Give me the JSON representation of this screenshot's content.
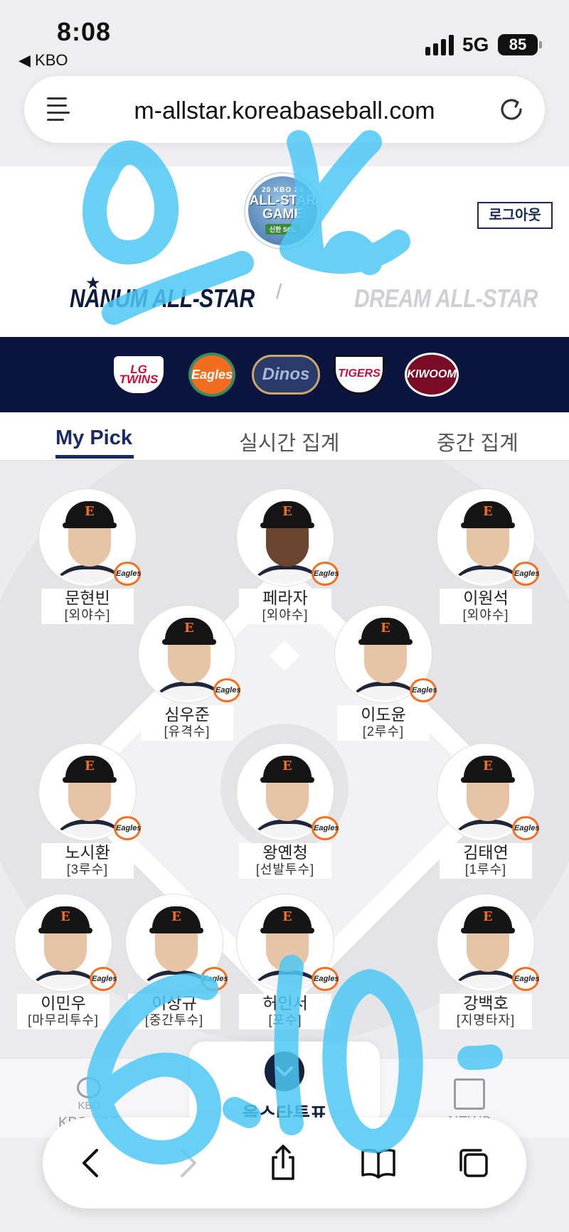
{
  "status": {
    "time": "8:08",
    "back_app": "◀ KBO",
    "network": "5G",
    "battery": "85"
  },
  "browser": {
    "url": "m-allstar.koreabaseball.com"
  },
  "header": {
    "logo_lines": [
      "20 KBO 24",
      "ALL-STAR",
      "GAME",
      "신한 SOL"
    ],
    "logout": "로그아웃",
    "nanum": "NANUM ALL-STAR",
    "divider": "/",
    "dream": "DREAM ALL-STAR"
  },
  "teams": [
    {
      "name": "LG TWINS",
      "short": "LG TWINS"
    },
    {
      "name": "Eagles",
      "short": "Eagles"
    },
    {
      "name": "NC Dinos",
      "short": "Dinos"
    },
    {
      "name": "KIA TIGERS",
      "short": "TIGERS"
    },
    {
      "name": "KIWOOM",
      "short": "KIWOOM"
    }
  ],
  "tabs": [
    "My Pick",
    "실시간 집계",
    "중간 집계"
  ],
  "badge_text": "Eagles",
  "players": [
    {
      "name": "문현빈",
      "position": "[외야수]"
    },
    {
      "name": "페라자",
      "position": "[외야수]"
    },
    {
      "name": "이원석",
      "position": "[외야수]"
    },
    {
      "name": "심우준",
      "position": "[유격수]"
    },
    {
      "name": "이도윤",
      "position": "[2루수]"
    },
    {
      "name": "노시환",
      "position": "[3루수]"
    },
    {
      "name": "왕옌청",
      "position": "[선발투수]"
    },
    {
      "name": "김태연",
      "position": "[1루수]"
    },
    {
      "name": "이민우",
      "position": "[마무리투수]"
    },
    {
      "name": "이상규",
      "position": "[중간투수]"
    },
    {
      "name": "허인서",
      "position": "[포수]"
    },
    {
      "name": "강백호",
      "position": "[지명타자]"
    }
  ],
  "bottom_nav": {
    "left_logo": "KBO",
    "left": "KBO APP",
    "center": "올스타투표",
    "right": "NEWS"
  },
  "handwriting": {
    "top": "오!",
    "bottom": "6.10"
  },
  "colors": {
    "navy": "#0c1540",
    "eagles_orange": "#f37021",
    "scribble": "#4ec8f4"
  }
}
